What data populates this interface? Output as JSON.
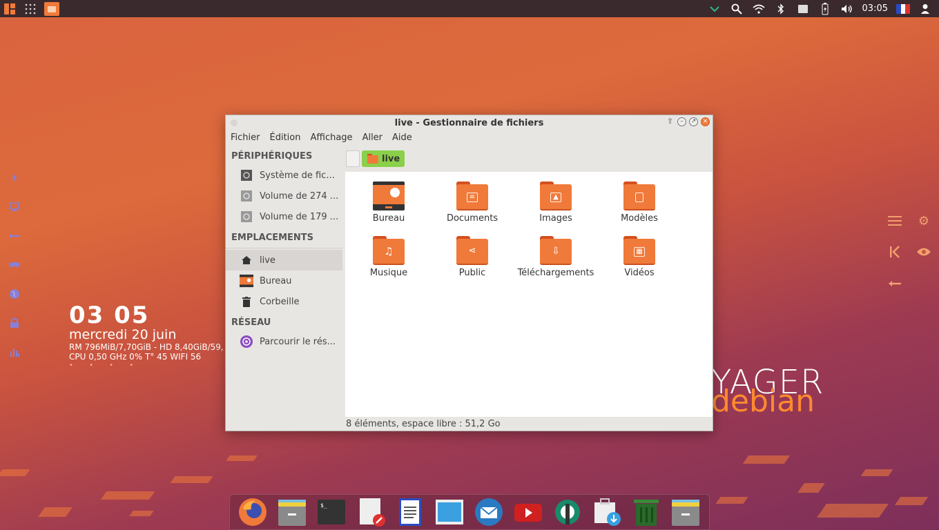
{
  "topbar": {
    "clock": "03:05",
    "flag": "FR"
  },
  "conky": {
    "time": "03 05",
    "date": "mercredi 20 juin",
    "ram_line": "RM 796MiB/7,70GiB - HD 8,40GiB/59,",
    "cpu_line": "CPU 0,50 GHz 0% T° 45  WIFI 56",
    "dots": "• • • •"
  },
  "brand": {
    "word1": "YAGER",
    "word2": "debian"
  },
  "window": {
    "title": "live - Gestionnaire de fichiers",
    "menu": [
      "Fichier",
      "Édition",
      "Affichage",
      "Aller",
      "Aide"
    ],
    "sidebar": {
      "devices_header": "PÉRIPHÉRIQUES",
      "devices": [
        "Système de fic...",
        "Volume de 274 ...",
        "Volume de 179 ..."
      ],
      "places_header": "EMPLACEMENTS",
      "places": [
        "live",
        "Bureau",
        "Corbeille"
      ],
      "network_header": "RÉSEAU",
      "network": [
        "Parcourir le rés..."
      ]
    },
    "path": "live",
    "items": [
      "Bureau",
      "Documents",
      "Images",
      "Modèles",
      "Musique",
      "Public",
      "Téléchargements",
      "Vidéos"
    ],
    "status": "8 éléments, espace libre : 51,2 Go"
  },
  "colors": {
    "accent": "#f07a3a",
    "path_green": "#8ad04a",
    "panel": "#3a2a2e"
  }
}
